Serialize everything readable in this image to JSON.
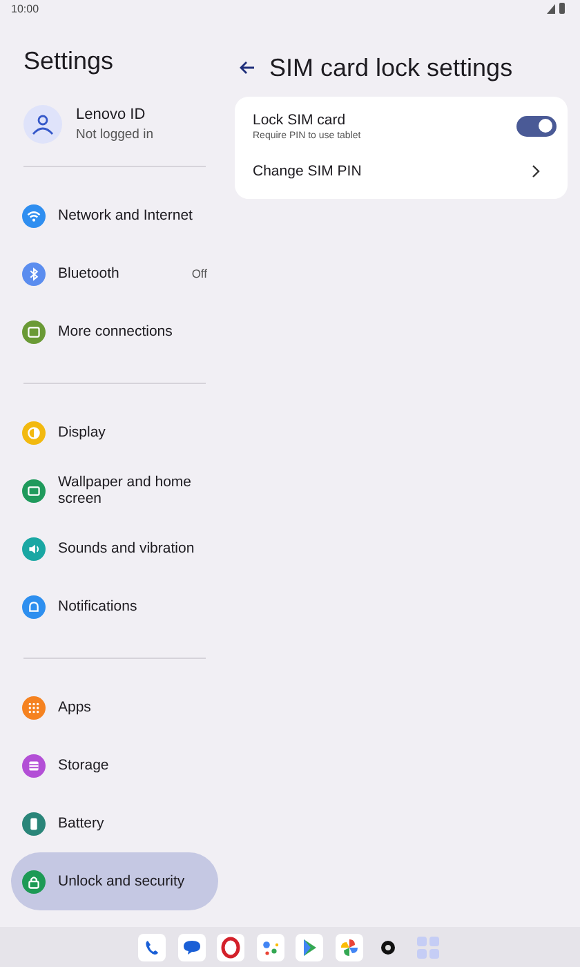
{
  "status_bar": {
    "time": "10:00"
  },
  "sidebar": {
    "title": "Settings",
    "account": {
      "name": "Lenovo ID",
      "status": "Not logged in"
    },
    "groups": [
      [
        {
          "kind": "wifi",
          "label": "Network and Internet",
          "color": "#2f8ef0",
          "selected": false
        },
        {
          "kind": "bluetooth",
          "label": "Bluetooth",
          "value": "Off",
          "color": "#5b8def",
          "selected": false
        },
        {
          "kind": "connections",
          "label": "More connections",
          "color": "#6a9a35",
          "selected": false
        }
      ],
      [
        {
          "kind": "display",
          "label": "Display",
          "color": "#f2b90f",
          "selected": false
        },
        {
          "kind": "wallpaper",
          "label": "Wallpaper and home screen",
          "color": "#1f9a5c",
          "selected": false
        },
        {
          "kind": "sound",
          "label": "Sounds and vibration",
          "color": "#1aa7a3",
          "selected": false
        },
        {
          "kind": "bell",
          "label": "Notifications",
          "color": "#2e8fef",
          "selected": false
        }
      ],
      [
        {
          "kind": "apps",
          "label": "Apps",
          "color": "#f58220",
          "selected": false
        },
        {
          "kind": "storage",
          "label": "Storage",
          "color": "#b34fd6",
          "selected": false
        },
        {
          "kind": "battery",
          "label": "Battery",
          "color": "#2a8579",
          "selected": false
        },
        {
          "kind": "lock",
          "label": "Unlock and security",
          "color": "#1d9a55",
          "selected": true
        }
      ]
    ]
  },
  "page": {
    "title": "SIM card lock settings",
    "rows": [
      {
        "kind": "toggle",
        "label": "Lock SIM card",
        "summary": "Require PIN to use tablet",
        "on": true
      },
      {
        "kind": "link",
        "label": "Change SIM PIN"
      }
    ]
  },
  "dock": [
    {
      "kind": "phone"
    },
    {
      "kind": "messages"
    },
    {
      "kind": "browser"
    },
    {
      "kind": "assistant"
    },
    {
      "kind": "store"
    },
    {
      "kind": "photos"
    },
    {
      "kind": "settings"
    },
    {
      "kind": "drawer"
    }
  ]
}
